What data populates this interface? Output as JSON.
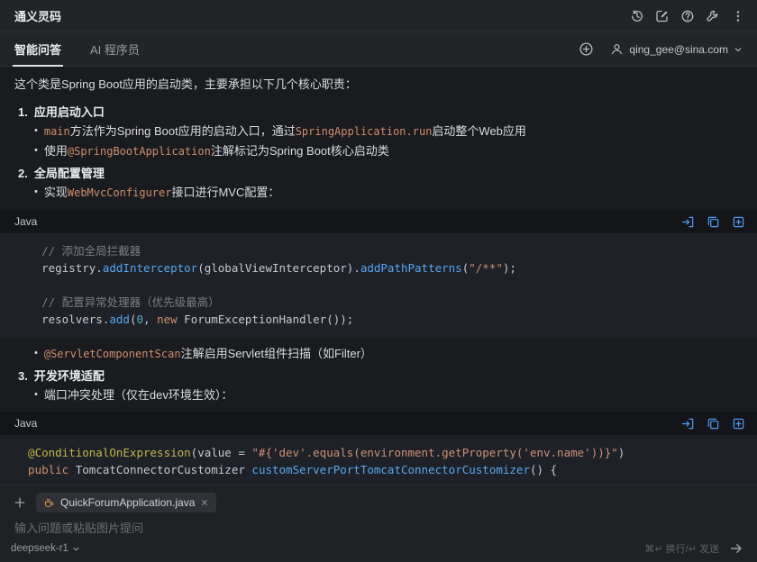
{
  "app": {
    "title": "通义灵码"
  },
  "tabs": [
    {
      "label": "智能问答",
      "active": true
    },
    {
      "label": "AI 程序员",
      "active": false
    }
  ],
  "account": {
    "email": "qing_gee@sina.com"
  },
  "colors": {
    "accent_blue": "#4f9cf5",
    "inline_code_orange": "#cf8e6d",
    "string_orange": "#ce9178",
    "annotation_yellow": "#c5b54d",
    "method_blue": "#57a7f2"
  },
  "chat": {
    "blocks": [
      {
        "type": "p",
        "segments": [
          {
            "t": "这个类是Spring Boot应用的启动类，主要承担以下几个核心职责："
          }
        ]
      },
      {
        "type": "li",
        "level": 1,
        "bold": true,
        "marker": "1.",
        "segments": [
          {
            "t": "应用启动入口"
          }
        ]
      },
      {
        "type": "li",
        "level": 2,
        "marker": "•",
        "segments": [
          {
            "s": "icode",
            "t": "main"
          },
          {
            "t": "方法作为Spring Boot应用的启动入口，通过"
          },
          {
            "s": "icode",
            "t": "SpringApplication.run"
          },
          {
            "t": "启动整个Web应用"
          }
        ]
      },
      {
        "type": "li",
        "level": 2,
        "marker": "•",
        "segments": [
          {
            "t": "使用"
          },
          {
            "s": "icode",
            "t": "@SpringBootApplication"
          },
          {
            "t": "注解标记为Spring Boot核心启动类"
          }
        ]
      },
      {
        "type": "li",
        "level": 1,
        "bold": true,
        "marker": "2.",
        "segments": [
          {
            "t": "全局配置管理"
          }
        ]
      },
      {
        "type": "li",
        "level": 2,
        "marker": "•",
        "segments": [
          {
            "t": "实现"
          },
          {
            "s": "icode",
            "t": "WebMvcConfigurer"
          },
          {
            "t": "接口进行MVC配置："
          }
        ]
      },
      {
        "type": "code",
        "lang": "Java",
        "lines": [
          [
            {
              "s": "cm",
              "t": "    // 添加全局拦截器"
            }
          ],
          [
            {
              "s": "pl",
              "t": "    registry."
            },
            {
              "s": "mt",
              "t": "addInterceptor"
            },
            {
              "s": "pl",
              "t": "(globalViewInterceptor)."
            },
            {
              "s": "mt",
              "t": "addPathPatterns"
            },
            {
              "s": "pl",
              "t": "("
            },
            {
              "s": "st",
              "t": "\"/**\""
            },
            {
              "s": "pl",
              "t": ");"
            }
          ],
          [],
          [
            {
              "s": "cm",
              "t": "    // 配置异常处理器（优先级最高）"
            }
          ],
          [
            {
              "s": "pl",
              "t": "    resolvers."
            },
            {
              "s": "mt",
              "t": "add"
            },
            {
              "s": "pl",
              "t": "("
            },
            {
              "s": "nm",
              "t": "0"
            },
            {
              "s": "pl",
              "t": ", "
            },
            {
              "s": "kw",
              "t": "new"
            },
            {
              "s": "pl",
              "t": " ForumExceptionHandler());"
            }
          ]
        ]
      },
      {
        "type": "li",
        "level": 2,
        "marker": "•",
        "segments": [
          {
            "s": "icode",
            "t": "@ServletComponentScan"
          },
          {
            "t": "注解启用Servlet组件扫描（如Filter）"
          }
        ]
      },
      {
        "type": "li",
        "level": 1,
        "bold": true,
        "marker": "3.",
        "segments": [
          {
            "t": "开发环境适配"
          }
        ]
      },
      {
        "type": "li",
        "level": 2,
        "marker": "•",
        "segments": [
          {
            "t": "端口冲突处理（仅在dev环境生效）："
          }
        ]
      },
      {
        "type": "code",
        "lang": "Java",
        "lines": [
          [
            {
              "s": "an",
              "t": "  @ConditionalOnExpression"
            },
            {
              "s": "pl",
              "t": "(value = "
            },
            {
              "s": "st",
              "t": "\"#{'dev'.equals(environment.getProperty('env.name'))}\""
            },
            {
              "s": "pl",
              "t": ")"
            }
          ],
          [
            {
              "s": "kw",
              "t": "  public"
            },
            {
              "s": "pl",
              "t": " TomcatConnectorCustomizer "
            },
            {
              "s": "mt",
              "t": "customServerPortTomcatConnectorCustomizer"
            },
            {
              "s": "pl",
              "t": "() {"
            }
          ]
        ]
      }
    ]
  },
  "composer": {
    "context_file": "QuickForumApplication.java",
    "placeholder": "输入问题或粘贴图片提问",
    "model": "deepseek-r1",
    "shortcut_hint": "⌘↵ 换行/↵ 发送"
  }
}
